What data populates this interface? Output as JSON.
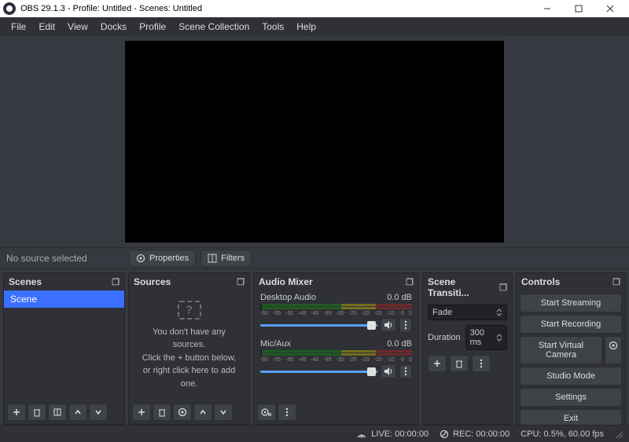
{
  "window": {
    "title": "OBS 29.1.3 - Profile: Untitled - Scenes: Untitled"
  },
  "menubar": [
    "File",
    "Edit",
    "View",
    "Docks",
    "Profile",
    "Scene Collection",
    "Tools",
    "Help"
  ],
  "source_toolbar": {
    "status": "No source selected",
    "properties": "Properties",
    "filters": "Filters"
  },
  "scenes": {
    "title": "Scenes",
    "items": [
      "Scene"
    ]
  },
  "sources": {
    "title": "Sources",
    "empty_line1": "You don't have any sources.",
    "empty_line2": "Click the + button below,",
    "empty_line3": "or right click here to add one."
  },
  "mixer": {
    "title": "Audio Mixer",
    "ticks": [
      "-60",
      "-55",
      "-50",
      "-45",
      "-40",
      "-35",
      "-30",
      "-25",
      "-20",
      "-15",
      "-10",
      "-5",
      "0"
    ],
    "items": [
      {
        "name": "Desktop Audio",
        "level": "0.0 dB"
      },
      {
        "name": "Mic/Aux",
        "level": "0.0 dB"
      }
    ]
  },
  "transitions": {
    "title": "Scene Transiti...",
    "selected": "Fade",
    "duration_label": "Duration",
    "duration_value": "300 ms"
  },
  "controls": {
    "title": "Controls",
    "start_streaming": "Start Streaming",
    "start_recording": "Start Recording",
    "start_virtual_camera": "Start Virtual Camera",
    "studio_mode": "Studio Mode",
    "settings": "Settings",
    "exit": "Exit"
  },
  "statusbar": {
    "live": "LIVE: 00:00:00",
    "rec": "REC: 00:00:00",
    "cpu": "CPU: 0.5%, 60.00 fps"
  }
}
